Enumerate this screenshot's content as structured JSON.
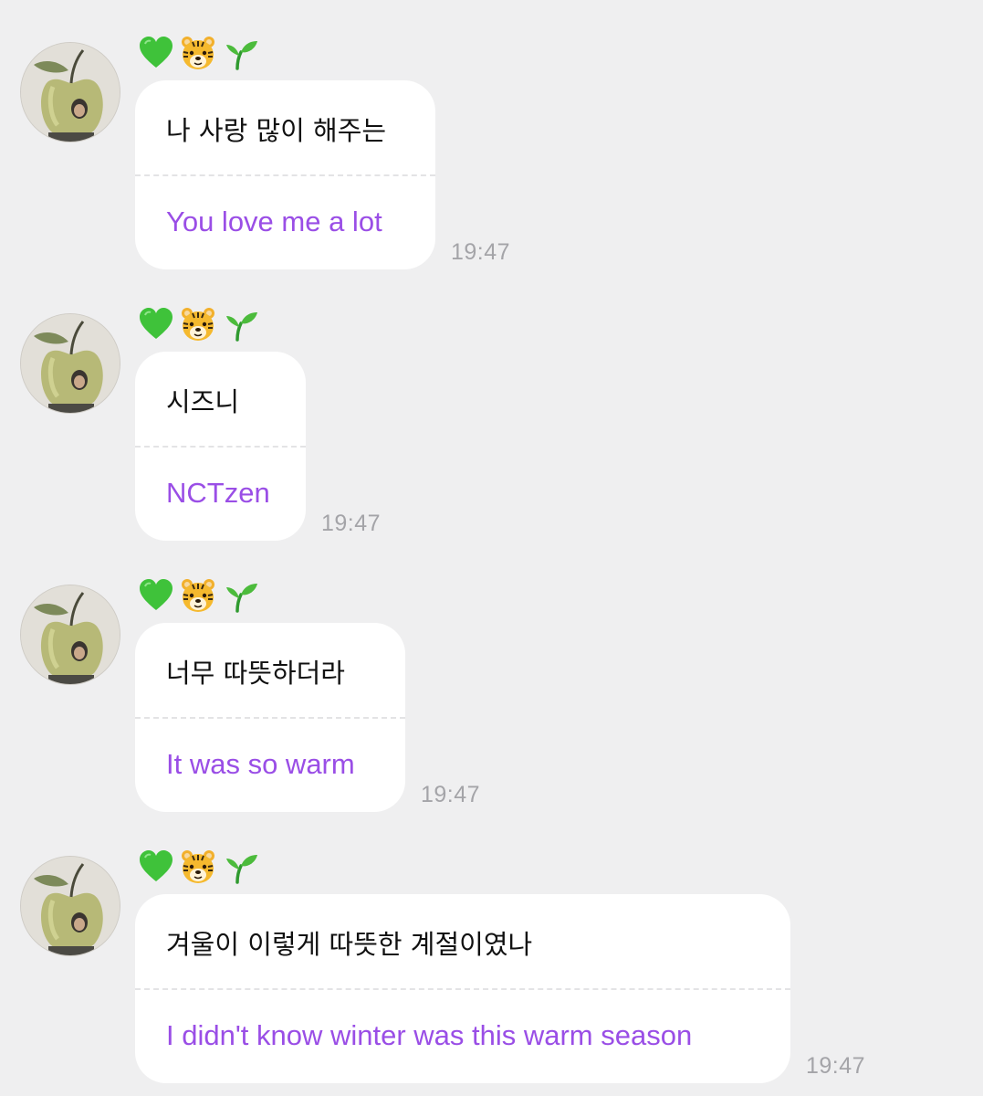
{
  "chat": {
    "background_color": "#efeff0",
    "bubble_color": "#ffffff",
    "translation_color": "#9a4ee6",
    "sender": {
      "badges": [
        "green-heart-icon",
        "tiger-face-icon",
        "seedling-icon"
      ]
    },
    "messages": [
      {
        "original": "나 사랑 많이 해주는",
        "translation": "You love me a lot",
        "time": "19:47"
      },
      {
        "original": "시즈니",
        "translation": "NCTzen",
        "time": "19:47"
      },
      {
        "original": "너무 따뜻하더라",
        "translation": "It was so warm",
        "time": "19:47"
      },
      {
        "original": "겨울이 이렇게 따뜻한 계절이였나",
        "translation": "I didn't know winter was this warm season",
        "time": "19:47"
      }
    ]
  }
}
